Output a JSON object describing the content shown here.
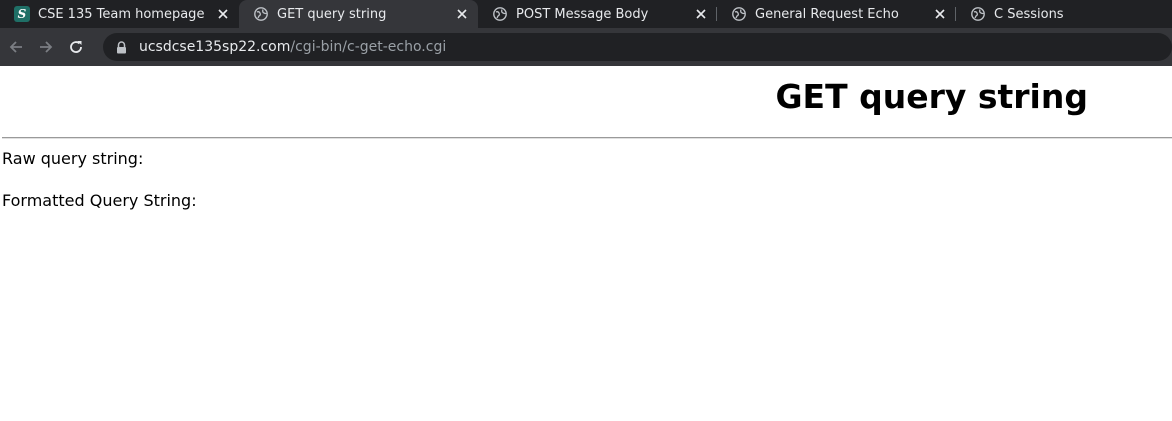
{
  "browser": {
    "tabs": [
      {
        "title": "CSE 135 Team homepage",
        "icon": "site-favicon-s",
        "active": false
      },
      {
        "title": "GET query string",
        "icon": "globe-icon",
        "active": true
      },
      {
        "title": "POST Message Body",
        "icon": "globe-icon",
        "active": false
      },
      {
        "title": "General Request Echo",
        "icon": "globe-icon",
        "active": false
      },
      {
        "title": "C Sessions",
        "icon": "globe-icon",
        "active": false
      }
    ],
    "favicon_letter": "S",
    "address": {
      "host": "ucsdcse135sp22.com",
      "path": "/cgi-bin/c-get-echo.cgi"
    }
  },
  "page": {
    "heading": "GET query string",
    "raw_label": "Raw query string:",
    "formatted_label": "Formatted Query String:"
  },
  "colors": {
    "tabstrip_bg": "#202124",
    "toolbar_bg": "#35363a",
    "favicon_bg": "#1f6f66"
  }
}
